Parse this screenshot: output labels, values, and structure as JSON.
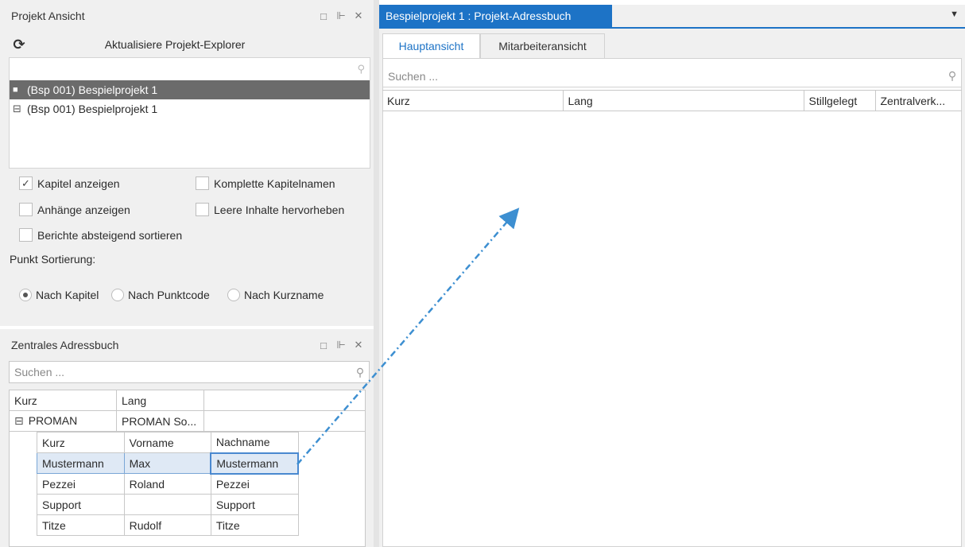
{
  "explorer": {
    "title": "Projekt Ansicht",
    "refresh_label": "Aktualisiere Projekt-Explorer",
    "tree": [
      {
        "label": "(Bsp 001) Bespielprojekt 1",
        "toggle": "■",
        "selected": true
      },
      {
        "label": "(Bsp 001) Bespielprojekt 1",
        "toggle": "⊟",
        "selected": false
      }
    ],
    "options": {
      "kapitel_anzeigen": {
        "label": "Kapitel anzeigen",
        "checked": true
      },
      "komplette_kapitelnamen": {
        "label": "Komplette Kapitelnamen",
        "checked": false
      },
      "anhaenge_anzeigen": {
        "label": "Anhänge anzeigen",
        "checked": false
      },
      "leere_inhalte": {
        "label": "Leere Inhalte hervorheben",
        "checked": false
      },
      "berichte_absteigend": {
        "label": "Berichte absteigend sortieren",
        "checked": false
      }
    },
    "sort_label": "Punkt Sortierung:",
    "sort_options": [
      {
        "label": "Nach Kapitel",
        "selected": true
      },
      {
        "label": "Nach Punktcode",
        "selected": false
      },
      {
        "label": "Nach Kurzname",
        "selected": false
      }
    ]
  },
  "addressbook": {
    "title": "Zentrales Adressbuch",
    "search_placeholder": "Suchen ...",
    "columns": [
      "Kurz",
      "Lang"
    ],
    "group": {
      "kurz": "PROMAN",
      "lang": "PROMAN So...",
      "toggle": "⊟"
    },
    "sub_columns": [
      "Kurz",
      "Vorname",
      "Nachname"
    ],
    "rows": [
      {
        "kurz": "Mustermann",
        "vorname": "Max",
        "nachname": "Mustermann",
        "selected": true
      },
      {
        "kurz": "Pezzei",
        "vorname": "Roland",
        "nachname": "Pezzei",
        "selected": false
      },
      {
        "kurz": "Support",
        "vorname": "",
        "nachname": "Support",
        "selected": false
      },
      {
        "kurz": "Titze",
        "vorname": "Rudolf",
        "nachname": "Titze",
        "selected": false
      }
    ]
  },
  "document": {
    "tab_title": "Bespielprojekt 1 : Projekt-Adressbuch",
    "tabs": [
      "Hauptansicht",
      "Mitarbeiteransicht"
    ],
    "active_tab": 0,
    "search_placeholder": "Suchen ...",
    "columns": [
      "Kurz",
      "Lang",
      "Stillgelegt",
      "Zentralverk..."
    ]
  },
  "colors": {
    "accent": "#1d73c6",
    "tree_selected": "#6b6b6b",
    "drag_arrow": "#3d8fd1"
  },
  "icons": {
    "refresh": "refresh-icon",
    "maximize": "maximize-icon",
    "pin": "pin-icon",
    "close": "close-icon",
    "search": "search-icon",
    "dropdown": "chevron-down-icon"
  }
}
